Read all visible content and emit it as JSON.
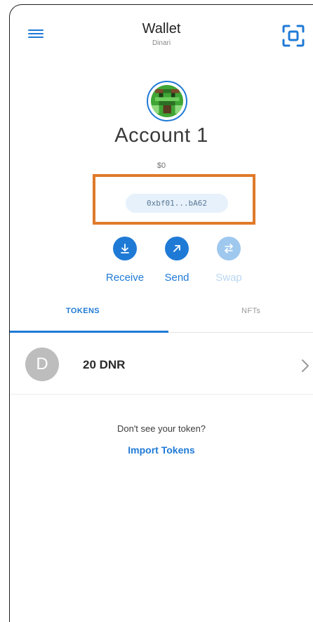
{
  "header": {
    "title": "Wallet",
    "network": "Dinari"
  },
  "account": {
    "name": "Account 1",
    "balance": "$0",
    "address": "0xbf01...bA62"
  },
  "actions": [
    {
      "label": "Receive",
      "icon": "download-icon",
      "enabled": true
    },
    {
      "label": "Send",
      "icon": "arrow-up-right-icon",
      "enabled": true
    },
    {
      "label": "Swap",
      "icon": "swap-icon",
      "enabled": false
    }
  ],
  "tabs": [
    {
      "label": "TOKENS",
      "active": true
    },
    {
      "label": "NFTs",
      "active": false
    }
  ],
  "tokens": [
    {
      "initial": "D",
      "balance": "20 DNR"
    }
  ],
  "footer": {
    "hint": "Don't see your token?",
    "import_label": "Import Tokens"
  },
  "colors": {
    "accent": "#1f7ad6",
    "highlight": "#e07a2a",
    "address_pill_bg": "#e6f1fb"
  }
}
